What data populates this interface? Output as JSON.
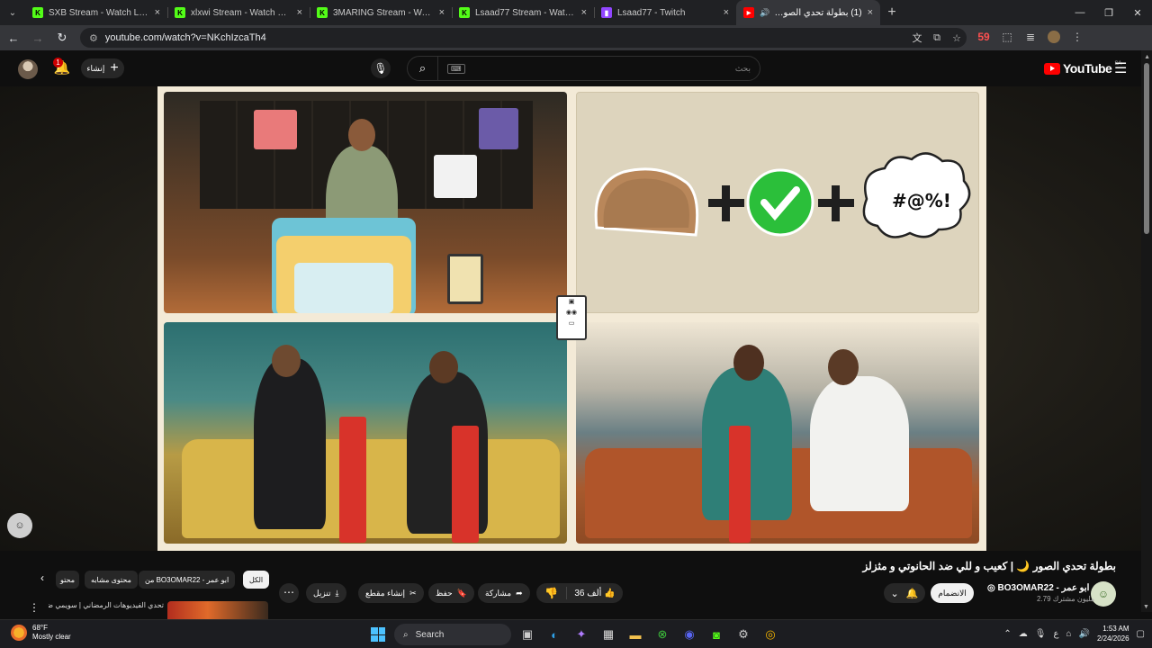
{
  "browser": {
    "tabs": [
      {
        "title": "SXB Stream - Watch Live on Kick",
        "favicon": "kick-icon",
        "kind": "kick"
      },
      {
        "title": "xlxwi Stream - Watch Live on Kick",
        "favicon": "kick-icon",
        "kind": "kick"
      },
      {
        "title": "3MARING Stream - Watch Live on Kick",
        "favicon": "kick-icon",
        "kind": "kick"
      },
      {
        "title": "Lsaad77 Stream - Watch Live on Kick",
        "favicon": "kick-icon",
        "kind": "kick"
      },
      {
        "title": "Lsaad77 - Twitch",
        "favicon": "twitch-icon",
        "kind": "twitch"
      }
    ],
    "active_tab": {
      "title": "(1) بطولة تحدي الصور | ك",
      "favicon": "youtube-icon"
    },
    "url": "youtube.com/watch?v=NKchIzcaTh4",
    "extension_badge": "59"
  },
  "youtube": {
    "create_label": "إنشاء",
    "notification_count": "1",
    "search_placeholder": "بحث",
    "keyboard_hint": "⌨",
    "logo_text": "YouTube",
    "country_code": "SA"
  },
  "video": {
    "title": "بطولة تحدي الصور 🌙 | كعيب و للي ضد الحانوتي و مثزلز",
    "channel_name": "BO3OMAR22 - ابو عمر",
    "channel_avatar_text": "☺",
    "subscribers": "2.79 مليون مشترك",
    "join_label": "الانضمام",
    "like_count": "36 ألف",
    "share_label": "مشاركة",
    "save_label": "حفظ",
    "clip_label": "إنشاء مقطع",
    "download_label": "تنزيل",
    "puzzle_symbols": "#@%!"
  },
  "chips": [
    {
      "label": "الكل",
      "selected": true
    },
    {
      "label": "من BO3OMAR22 - ابو عمر",
      "selected": false
    },
    {
      "label": "محتوى مشابه",
      "selected": false
    },
    {
      "label": "محتو",
      "selected": false
    }
  ],
  "recommendation": {
    "title": "تحدي الفيديوهات الرمضاني | سويمي ضد عادي"
  },
  "taskbar": {
    "temperature": "68°F",
    "weather": "Mostly clear",
    "search_label": "Search",
    "time": "1:53 AM",
    "date": "2/24/2026",
    "lang": "ع"
  },
  "colors": {
    "youtube_red": "#ff0000",
    "kick_green": "#53fc18",
    "twitch_purple": "#9146ff",
    "check_green": "#2bbf3a"
  }
}
